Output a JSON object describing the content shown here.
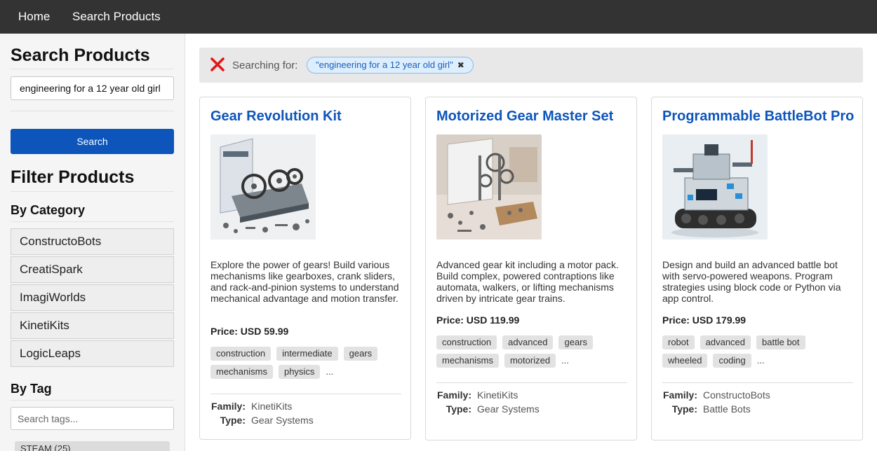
{
  "nav": {
    "home": "Home",
    "search_products": "Search Products"
  },
  "sidebar": {
    "search_heading": "Search Products",
    "search_value": "engineering for a 12 year old girl",
    "search_button": "Search",
    "filter_heading": "Filter Products",
    "category_heading": "By Category",
    "categories": [
      "ConstructoBots",
      "CreatiSpark",
      "ImagiWorlds",
      "KinetiKits",
      "LogicLeaps"
    ],
    "tag_heading": "By Tag",
    "tag_search_placeholder": "Search tags...",
    "tags": [
      "STEAM (25)"
    ]
  },
  "banner": {
    "label": "Searching for:",
    "query": "\"engineering for a 12 year old girl\"",
    "clear_color": "#e01818"
  },
  "colors": {
    "accent": "#0d55bb",
    "topnav": "#333333"
  },
  "products": [
    {
      "title": "Gear Revolution Kit",
      "image_alt": "gear kit box with metal gear assembly",
      "description": "Explore the power of gears! Build various mechanisms like gearboxes, crank sliders, and rack-and-pinion systems to understand mechanical advantage and motion transfer.",
      "price": "Price: USD 59.99",
      "tags": [
        "construction",
        "intermediate",
        "gears",
        "mechanisms",
        "physics"
      ],
      "more": "...",
      "family_label": "Family:",
      "family": "KinetiKits",
      "type_label": "Type:",
      "type": "Gear Systems"
    },
    {
      "title": "Motorized Gear Master Set",
      "image_alt": "motorized gear set with parts tray",
      "description": "Advanced gear kit including a motor pack. Build complex, powered contraptions like automata, walkers, or lifting mechanisms driven by intricate gear trains.",
      "price": "Price: USD 119.99",
      "tags": [
        "construction",
        "advanced",
        "gears",
        "mechanisms",
        "motorized"
      ],
      "more": "...",
      "family_label": "Family:",
      "family": "KinetiKits",
      "type_label": "Type:",
      "type": "Gear Systems"
    },
    {
      "title": "Programmable BattleBot Pro",
      "image_alt": "tracked battle robot",
      "description": "Design and build an advanced battle bot with servo-powered weapons. Program strategies using block code or Python via app control.",
      "price": "Price: USD 179.99",
      "tags": [
        "robot",
        "advanced",
        "battle bot",
        "wheeled",
        "coding"
      ],
      "more": "...",
      "family_label": "Family:",
      "family": "ConstructoBots",
      "type_label": "Type:",
      "type": "Battle Bots"
    }
  ]
}
